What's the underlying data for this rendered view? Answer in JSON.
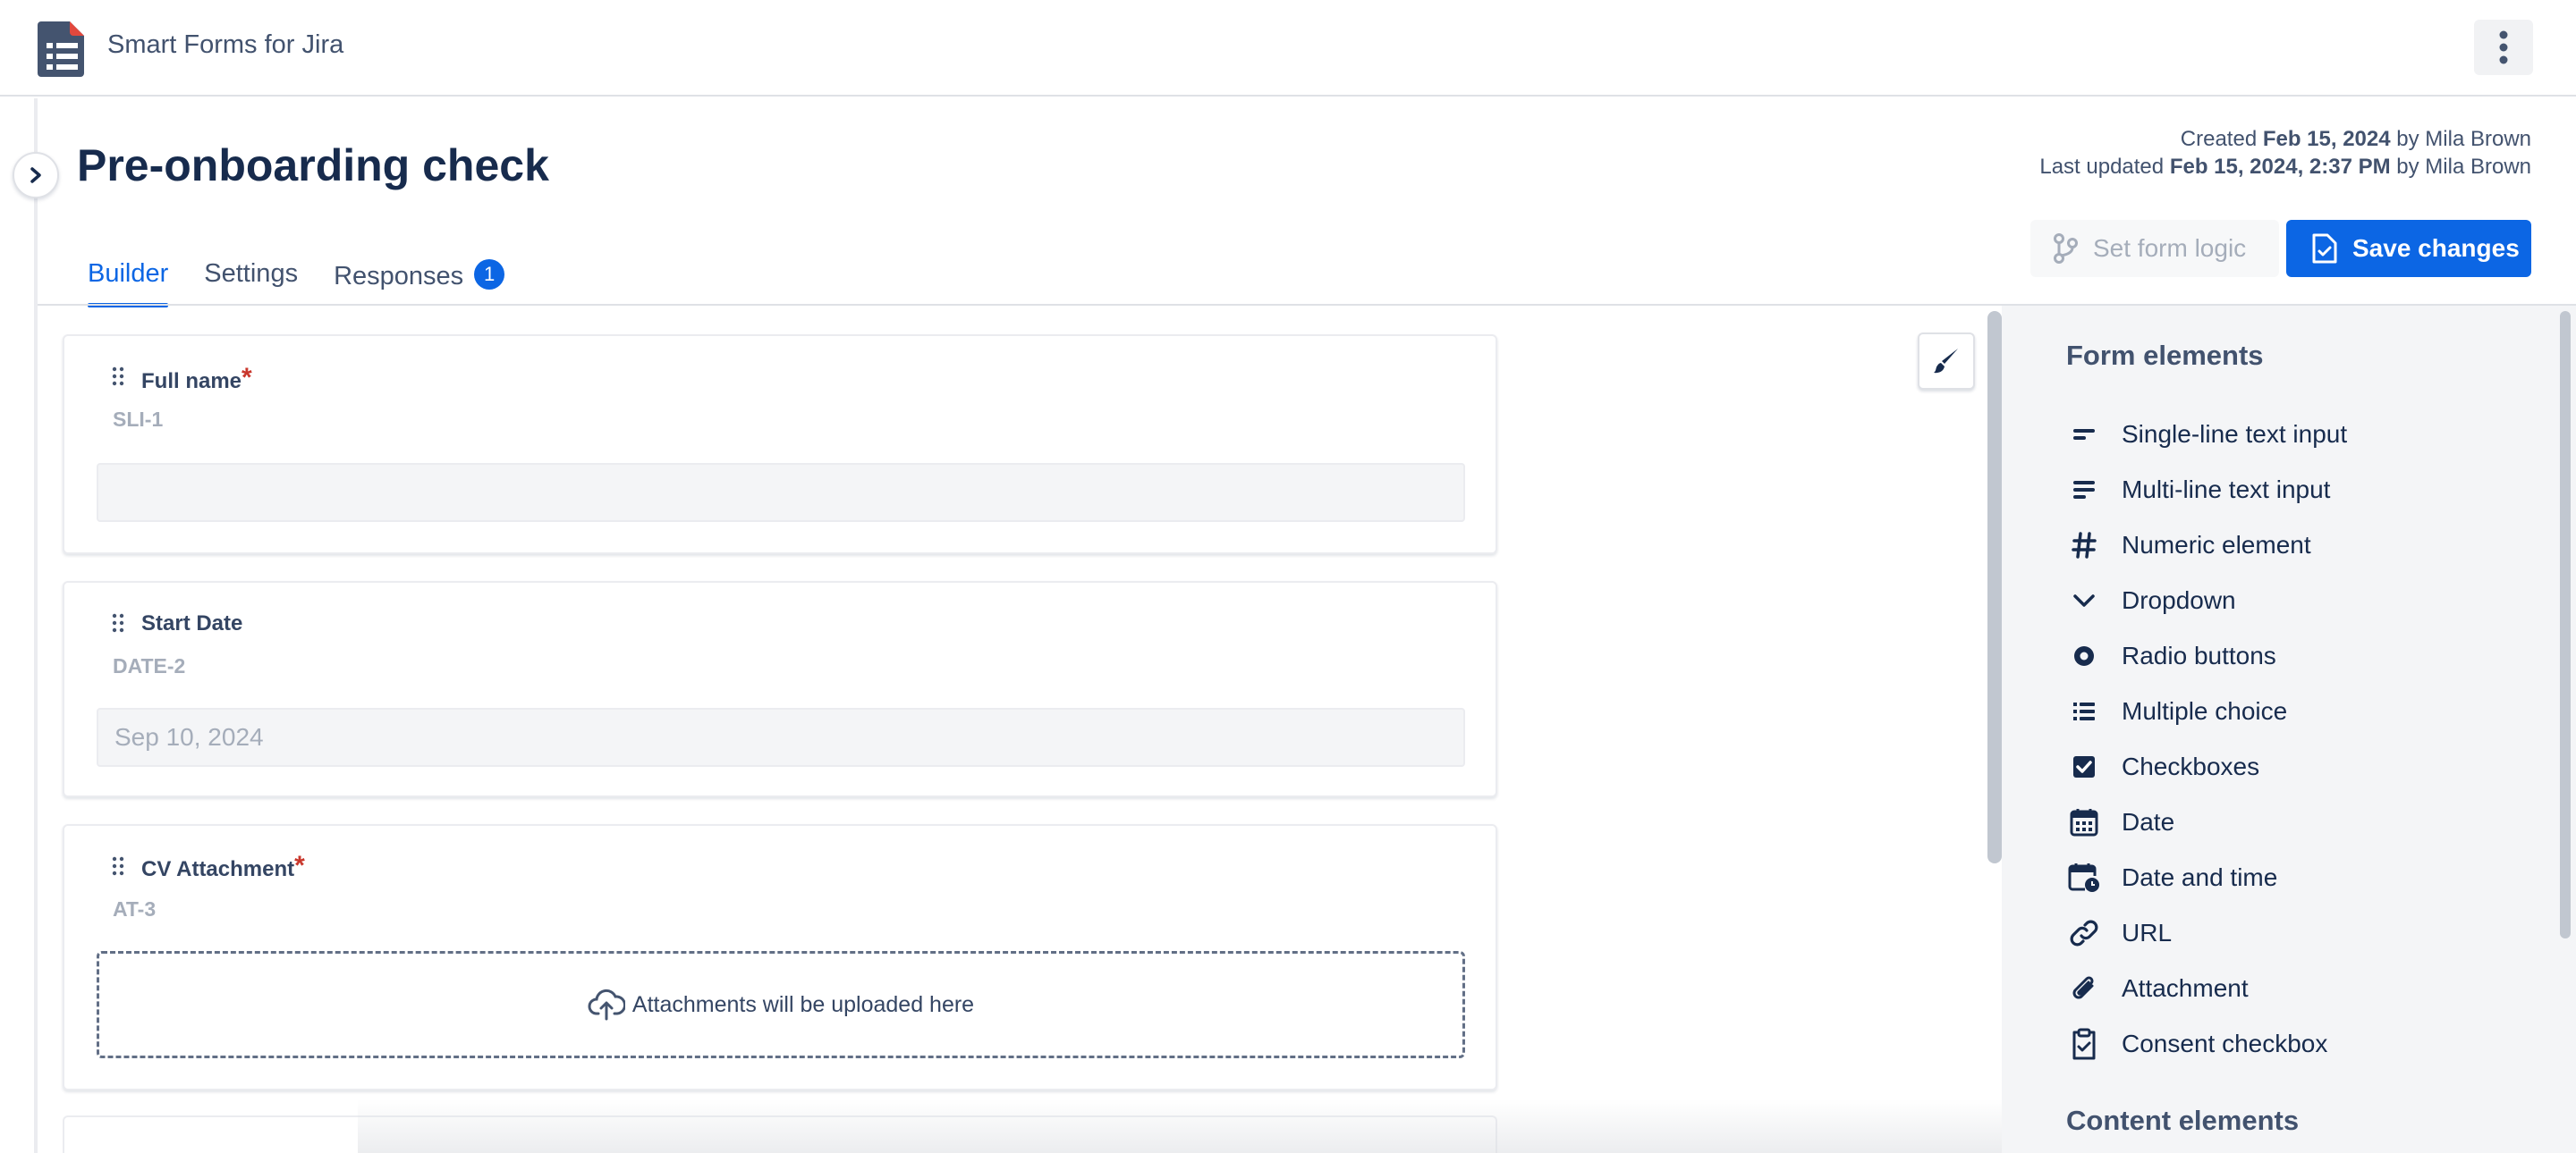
{
  "app": {
    "title": "Smart Forms for Jira",
    "logo": "form-list-icon"
  },
  "page": {
    "title": "Pre-onboarding check"
  },
  "meta": {
    "created_prefix": "Created",
    "created_date": "Feb 15, 2024",
    "created_by": "by Mila Brown",
    "updated_prefix": "Last updated",
    "updated_date": "Feb 15, 2024, 2:37 PM",
    "updated_by": "by Mila Brown"
  },
  "tabs": [
    {
      "label": "Builder",
      "active": true
    },
    {
      "label": "Settings",
      "active": false
    },
    {
      "label": "Responses",
      "active": false,
      "badge": "1"
    }
  ],
  "actions": {
    "logic_label": "Set form logic",
    "save_label": "Save changes"
  },
  "fields": [
    {
      "label": "Full name",
      "required": true,
      "key": "SLI-1",
      "value": ""
    },
    {
      "label": "Start Date",
      "required": false,
      "key": "DATE-2",
      "value": "Sep 10, 2024"
    },
    {
      "label": "CV Attachment",
      "required": true,
      "key": "AT-3",
      "dropzone": "Attachments will be uploaded here"
    }
  ],
  "panel": {
    "form_heading": "Form elements",
    "items": [
      {
        "label": "Single-line text input",
        "icon": "short-text-icon"
      },
      {
        "label": "Multi-line text input",
        "icon": "long-text-icon"
      },
      {
        "label": "Numeric element",
        "icon": "hash-icon"
      },
      {
        "label": "Dropdown",
        "icon": "chevron-down-icon"
      },
      {
        "label": "Radio buttons",
        "icon": "radio-icon"
      },
      {
        "label": "Multiple choice",
        "icon": "list-icon"
      },
      {
        "label": "Checkboxes",
        "icon": "checkbox-icon"
      },
      {
        "label": "Date",
        "icon": "calendar-icon"
      },
      {
        "label": "Date and time",
        "icon": "calendar-clock-icon"
      },
      {
        "label": "URL",
        "icon": "link-icon"
      },
      {
        "label": "Attachment",
        "icon": "paperclip-icon"
      },
      {
        "label": "Consent checkbox",
        "icon": "clipboard-check-icon"
      }
    ],
    "content_heading": "Content elements"
  },
  "colors": {
    "accent": "#0C66E4",
    "text": "#172B4D",
    "required": "#C9372C",
    "panel_bg": "#F4F5F7"
  }
}
